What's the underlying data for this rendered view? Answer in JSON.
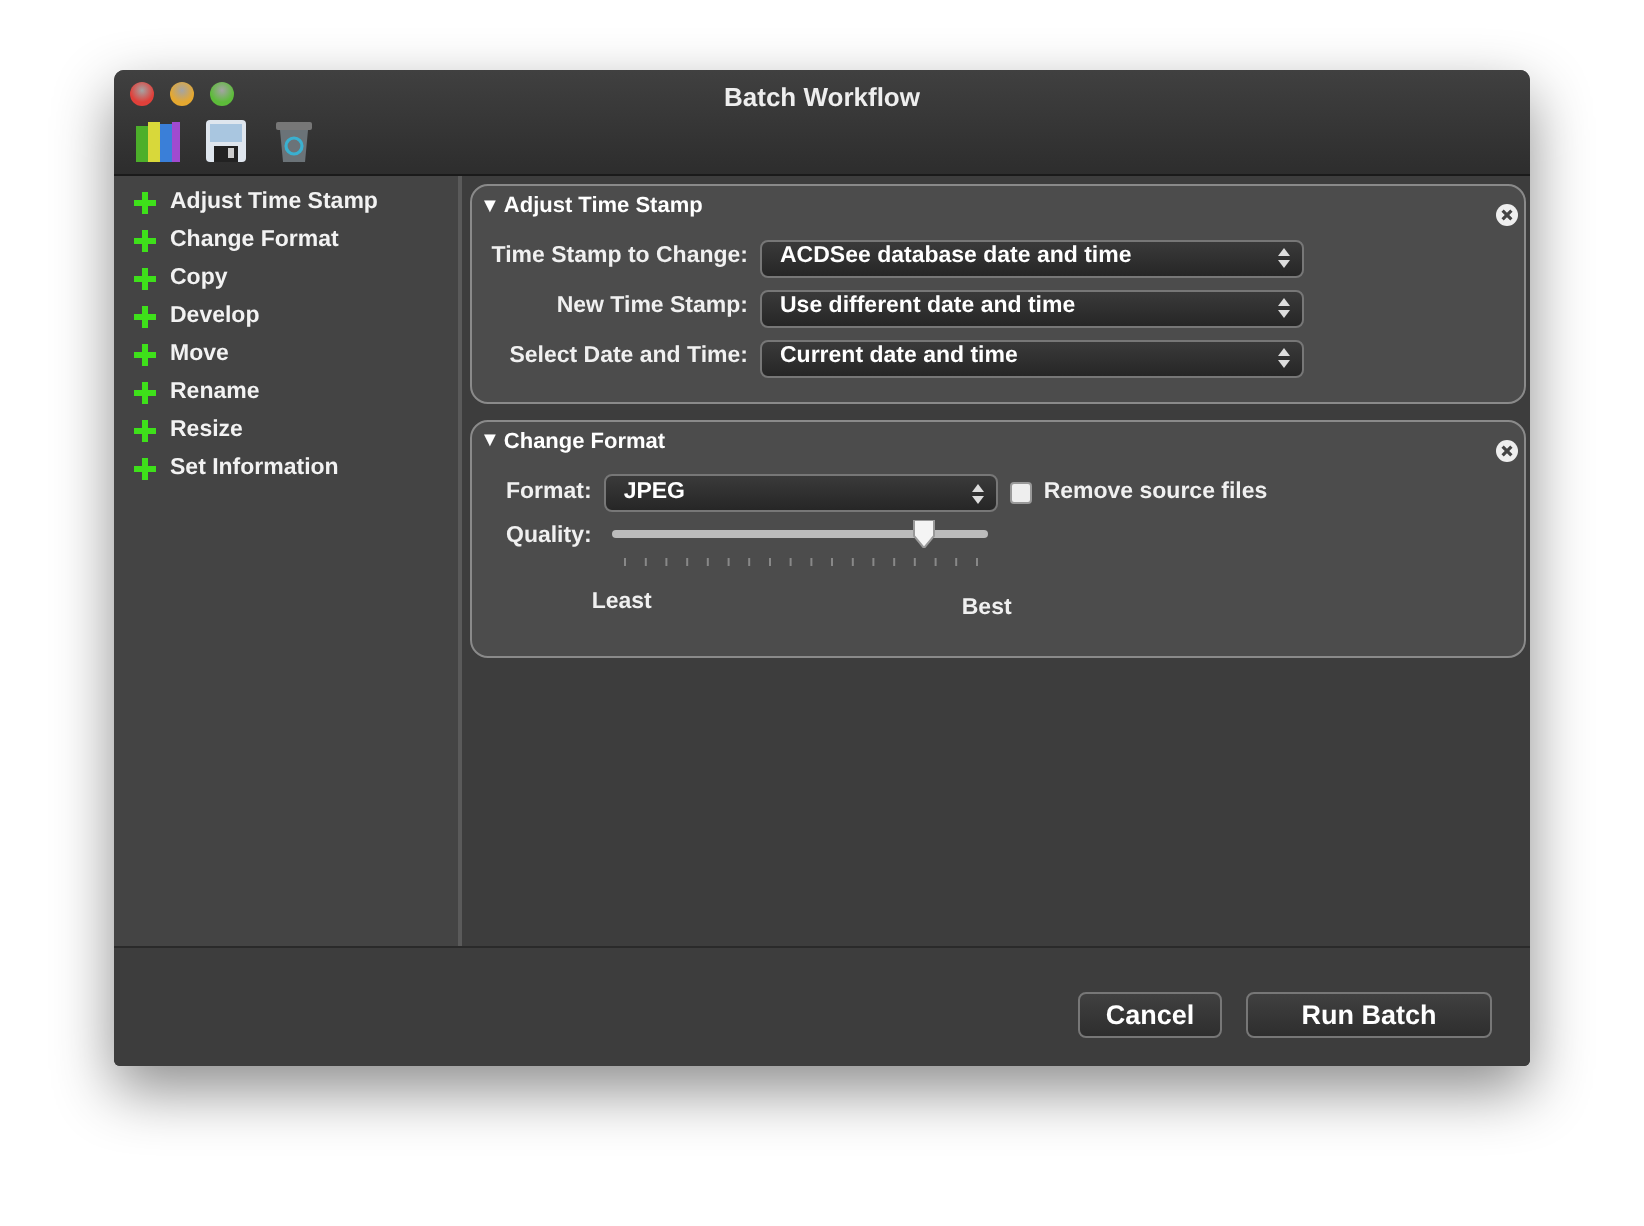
{
  "window": {
    "title": "Batch Workflow"
  },
  "toolbar": {
    "items": [
      {
        "kind": "books"
      },
      {
        "kind": "save"
      },
      {
        "kind": "trash"
      }
    ]
  },
  "sidebar": {
    "items": [
      {
        "label": "Adjust Time Stamp"
      },
      {
        "label": "Change Format"
      },
      {
        "label": "Copy"
      },
      {
        "label": "Develop"
      },
      {
        "label": "Move"
      },
      {
        "label": "Rename"
      },
      {
        "label": "Resize"
      },
      {
        "label": "Set Information"
      }
    ]
  },
  "panels": [
    {
      "toggle": "▼",
      "title": "Adjust Time Stamp",
      "expanded": true,
      "rows": [
        {
          "kind": "select",
          "label": "Time Stamp to Change:",
          "value": "ACDSee database date and time"
        },
        {
          "kind": "select",
          "label": "New Time Stamp:",
          "value": "Use different date and time"
        },
        {
          "kind": "select",
          "label": "Select Date and Time:",
          "value": "Current date and time"
        }
      ]
    },
    {
      "toggle": "▼",
      "title": "Change Format",
      "expanded": true,
      "rows": [
        {
          "kind": "select_check",
          "label": "Format:",
          "value": "JPEG",
          "check_label": "Remove source files",
          "checked": false
        },
        {
          "kind": "slider",
          "label": "Quality:",
          "level": 0.83,
          "min_label": "Least",
          "max_label": "Best"
        }
      ]
    }
  ],
  "buttons": [
    {
      "label": "Cancel"
    },
    {
      "label": "Run Batch"
    }
  ]
}
